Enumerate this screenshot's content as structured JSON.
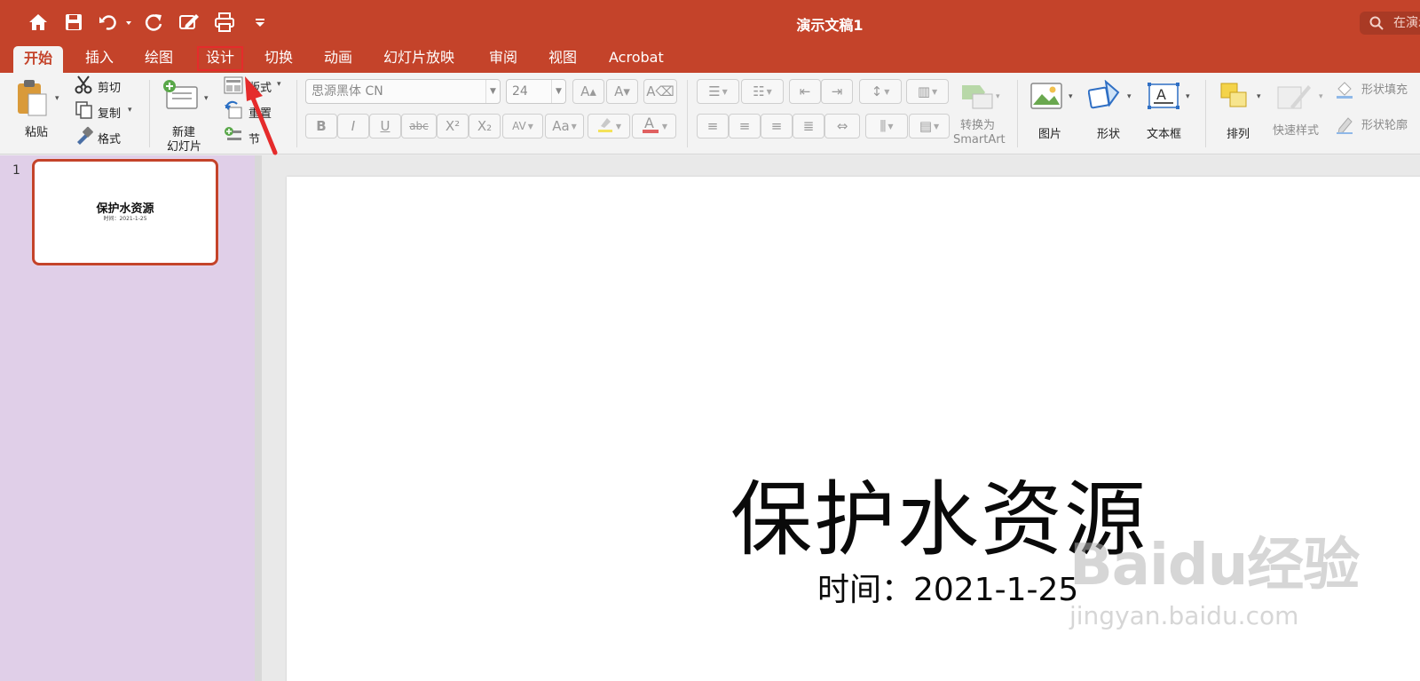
{
  "window": {
    "title": "演示文稿1",
    "search_placeholder": "在演示文稿中搜索"
  },
  "tabs": [
    {
      "label": "开始",
      "active": true
    },
    {
      "label": "插入"
    },
    {
      "label": "绘图"
    },
    {
      "label": "设计",
      "highlighted": true
    },
    {
      "label": "切换"
    },
    {
      "label": "动画"
    },
    {
      "label": "幻灯片放映"
    },
    {
      "label": "审阅"
    },
    {
      "label": "视图"
    },
    {
      "label": "Acrobat"
    }
  ],
  "ribbon": {
    "clipboard": {
      "paste": "粘贴",
      "cut": "剪切",
      "copy": "复制",
      "format": "格式"
    },
    "slides": {
      "new_slide_line1": "新建",
      "new_slide_line2": "幻灯片",
      "layout": "版式",
      "reset": "重置",
      "section": "节"
    },
    "font": {
      "font_name": "思源黑体 CN",
      "font_size": "24"
    },
    "paragraph": {
      "smartart_line1": "转换为",
      "smartart_line2": "SmartArt"
    },
    "insert": {
      "picture": "图片",
      "shape": "形状",
      "textbox": "文本框"
    },
    "drawing": {
      "arrange": "排列",
      "quick_styles": "快速样式",
      "shape_fill": "形状填充",
      "shape_outline": "形状轮廓"
    }
  },
  "thumbnails": [
    {
      "number": "1",
      "title": "保护水资源",
      "subtitle": "时间：2021-1-25"
    }
  ],
  "slide": {
    "title": "保护水资源",
    "subtitle": "时间：2021-1-25"
  },
  "watermark": {
    "brand": "Baidu经验",
    "url": "jingyan.baidu.com"
  },
  "colors": {
    "accent": "#c4432a",
    "thumbnail_pane": "#e0cfe8",
    "annotation": "#e52b2b"
  }
}
